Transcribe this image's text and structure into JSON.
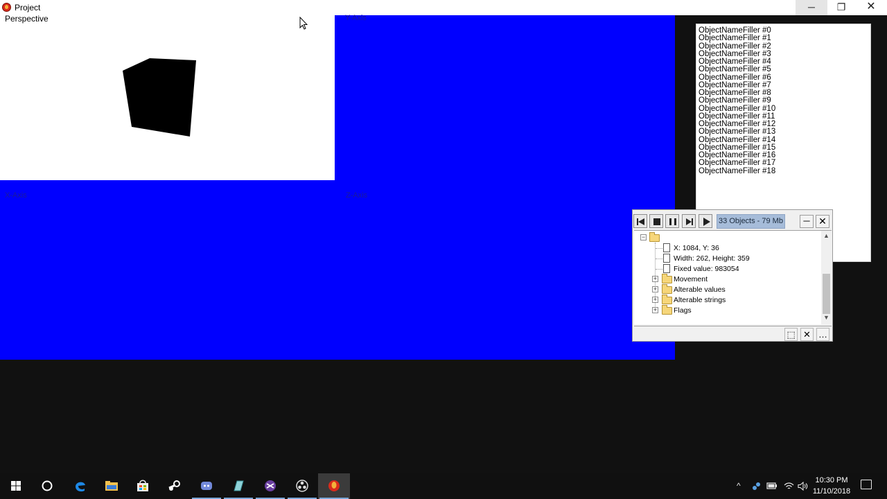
{
  "app": {
    "title": "Project",
    "icon": "fireball-app-icon"
  },
  "window_controls": {
    "minimize": "─",
    "restore": "❐",
    "close": "✕"
  },
  "viewports": {
    "perspective_label": "Perspective",
    "y_axis_label": "Y-Axis",
    "x_axis_label": "X-Axis",
    "z_axis_label": "Z-Axis",
    "background_color": "#0000ff",
    "perspective_background": "#ffffff"
  },
  "object_list": [
    "ObjectNameFiller #0",
    "ObjectNameFiller #1",
    "ObjectNameFiller #2",
    "ObjectNameFiller #3",
    "ObjectNameFiller #4",
    "ObjectNameFiller #5",
    "ObjectNameFiller #6",
    "ObjectNameFiller #7",
    "ObjectNameFiller #8",
    "ObjectNameFiller #9",
    "ObjectNameFiller #10",
    "ObjectNameFiller #11",
    "ObjectNameFiller #12",
    "ObjectNameFiller #13",
    "ObjectNameFiller #14",
    "ObjectNameFiller #15",
    "ObjectNameFiller #16",
    "ObjectNameFiller #17",
    "ObjectNameFiller #18"
  ],
  "debugger": {
    "status": "33 Objects - 79 Mb",
    "minimize_label": "─",
    "close_label": "✕",
    "tree": {
      "position": "X: 1084, Y: 36",
      "size": "Width: 262, Height: 359",
      "fixed_value": "Fixed value: 983054",
      "movement": "Movement",
      "alterable_values": "Alterable values",
      "alterable_strings": "Alterable strings",
      "flags": "Flags"
    },
    "tools": {
      "add": "⬚",
      "remove": "✕",
      "more": "…"
    }
  },
  "taskbar": {
    "items": [
      "start-icon",
      "cortana-icon",
      "edge-icon",
      "file-explorer-icon",
      "store-icon",
      "steam-icon",
      "discord-icon",
      "app-icon",
      "visual-studio-icon",
      "obs-icon",
      "fusion-icon"
    ],
    "time": "10:30 PM",
    "date": "11/10/2018"
  }
}
